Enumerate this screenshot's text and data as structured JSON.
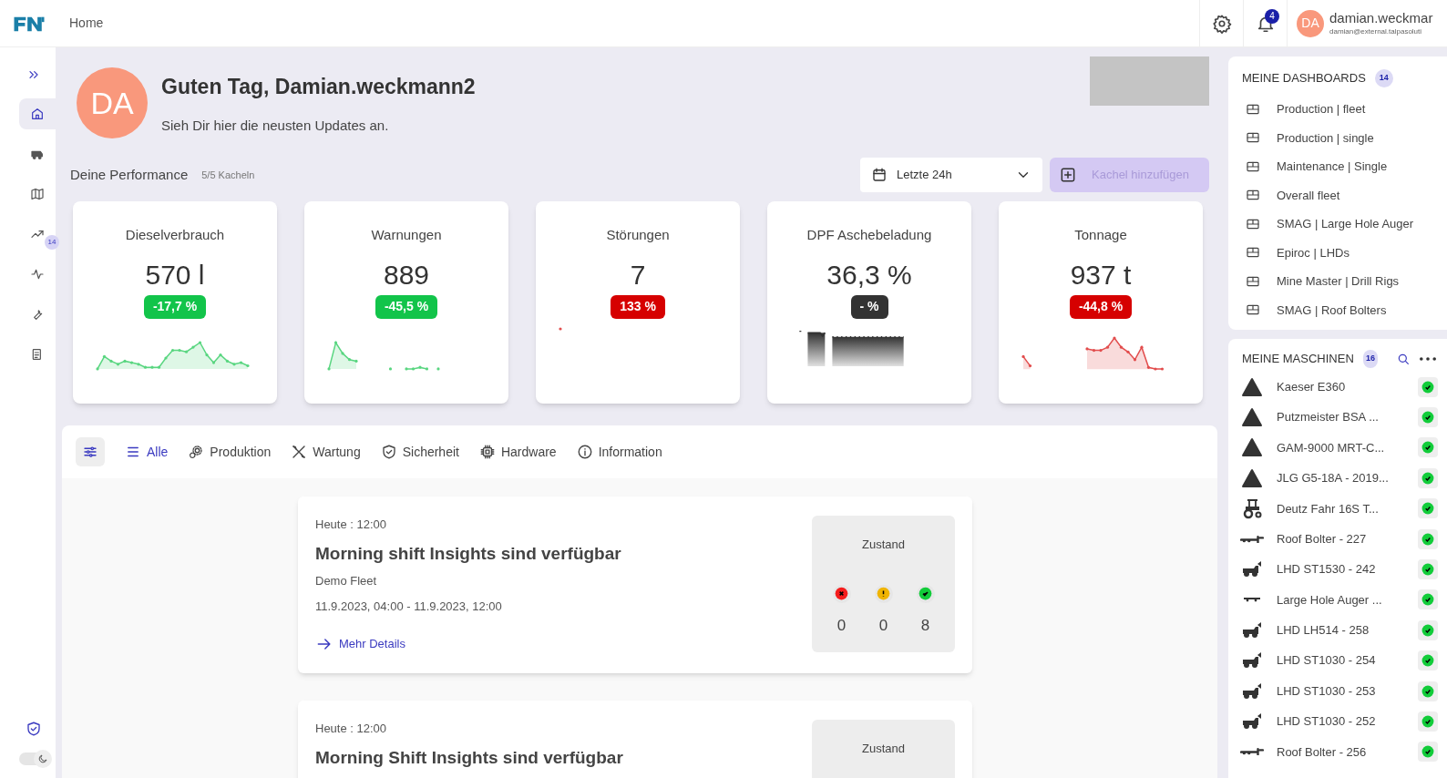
{
  "header": {
    "breadcrumb": "Home",
    "notification_count": "4",
    "user": {
      "initials": "DA",
      "name": "damian.weckmar",
      "email": "damian@external.talpasoluti"
    }
  },
  "sidebar": {
    "items": [
      {
        "kind": "home",
        "selected": true
      },
      {
        "kind": "machines",
        "selected": false
      },
      {
        "kind": "map",
        "selected": false
      },
      {
        "kind": "trend",
        "selected": false,
        "badge": "14"
      },
      {
        "kind": "pulse",
        "selected": false
      },
      {
        "kind": "wrench",
        "selected": false
      },
      {
        "kind": "report",
        "selected": false
      }
    ],
    "dark_mode": {
      "on": false
    }
  },
  "greeting": {
    "initials": "DA",
    "title": "Guten Tag, Damian.weckmann2",
    "subtitle": "Sieh Dir hier die neusten Updates an."
  },
  "performance": {
    "title": "Deine Performance",
    "tile_count": "5/5 Kacheln",
    "range": "Letzte 24h",
    "add_button": {
      "label": "Kachel hinzufügen",
      "disabled": true
    },
    "tiles": [
      {
        "title": "Dieselverbrauch",
        "value": "570 l",
        "change": "-17,7 %",
        "color": "#12c44a"
      },
      {
        "title": "Warnungen",
        "value": "889",
        "change": "-45,5 %",
        "color": "#12c44a"
      },
      {
        "title": "Störungen",
        "value": "7",
        "change": "133 %",
        "color": "#d60000"
      },
      {
        "title": "DPF Aschebeladung",
        "value": "36,3 %",
        "change": "- %",
        "color": "#333333"
      },
      {
        "title": "Tonnage",
        "value": "937 t",
        "change": "-44,8 %",
        "color": "#d60000"
      }
    ]
  },
  "filters": [
    {
      "label": "Alle",
      "kind": "list",
      "selected": true
    },
    {
      "label": "Produktion",
      "kind": "gears",
      "selected": false
    },
    {
      "label": "Wartung",
      "kind": "tools",
      "selected": false
    },
    {
      "label": "Sicherheit",
      "kind": "shield",
      "selected": false
    },
    {
      "label": "Hardware",
      "kind": "chip",
      "selected": false
    },
    {
      "label": "Information",
      "kind": "info",
      "selected": false
    }
  ],
  "feed": [
    {
      "time": "Heute : 12:00",
      "title": "Morning shift Insights sind verfügbar",
      "fleet": "Demo Fleet",
      "period": "11.9.2023, 04:00 - 11.9.2023, 12:00",
      "link": "Mehr Details",
      "status_title": "Zustand",
      "status": [
        {
          "kind": "error",
          "count": "0"
        },
        {
          "kind": "warning",
          "count": "0"
        },
        {
          "kind": "ok",
          "count": "8"
        }
      ]
    },
    {
      "time": "Heute : 12:00",
      "title": "Morning Shift Insights sind verfügbar",
      "status_title": "Zustand"
    }
  ],
  "dashboards": {
    "title": "MEINE DASHBOARDS",
    "count": "14",
    "items": [
      "Production | fleet",
      "Production | single",
      "Maintenance | Single",
      "Overall fleet",
      "SMAG | Large Hole Auger",
      "Epiroc | LHDs",
      "Mine Master | Drill Rigs",
      "SMAG | Roof Bolters"
    ]
  },
  "machines": {
    "title": "MEINE MASCHINEN",
    "count": "16",
    "items": [
      {
        "name": "Kaeser E360",
        "kind": "cone",
        "ok": true
      },
      {
        "name": "Putzmeister BSA ...",
        "kind": "cone",
        "ok": true
      },
      {
        "name": "GAM-9000 MRT-C...",
        "kind": "cone",
        "ok": true
      },
      {
        "name": "JLG G5-18A - 2019...",
        "kind": "cone",
        "ok": true
      },
      {
        "name": "Deutz Fahr 16S T...",
        "kind": "tractor",
        "ok": true
      },
      {
        "name": "Roof Bolter - 227",
        "kind": "bolter",
        "ok": true
      },
      {
        "name": "LHD ST1530 - 242",
        "kind": "loader",
        "ok": true
      },
      {
        "name": "Large Hole Auger ...",
        "kind": "auger",
        "ok": true
      },
      {
        "name": "LHD LH514 - 258",
        "kind": "loader",
        "ok": true
      },
      {
        "name": "LHD ST1030 - 254",
        "kind": "loader",
        "ok": true
      },
      {
        "name": "LHD ST1030 - 253",
        "kind": "loader",
        "ok": true
      },
      {
        "name": "LHD ST1030 - 252",
        "kind": "loader",
        "ok": true
      },
      {
        "name": "Roof Bolter - 256",
        "kind": "bolter",
        "ok": true
      }
    ]
  }
}
